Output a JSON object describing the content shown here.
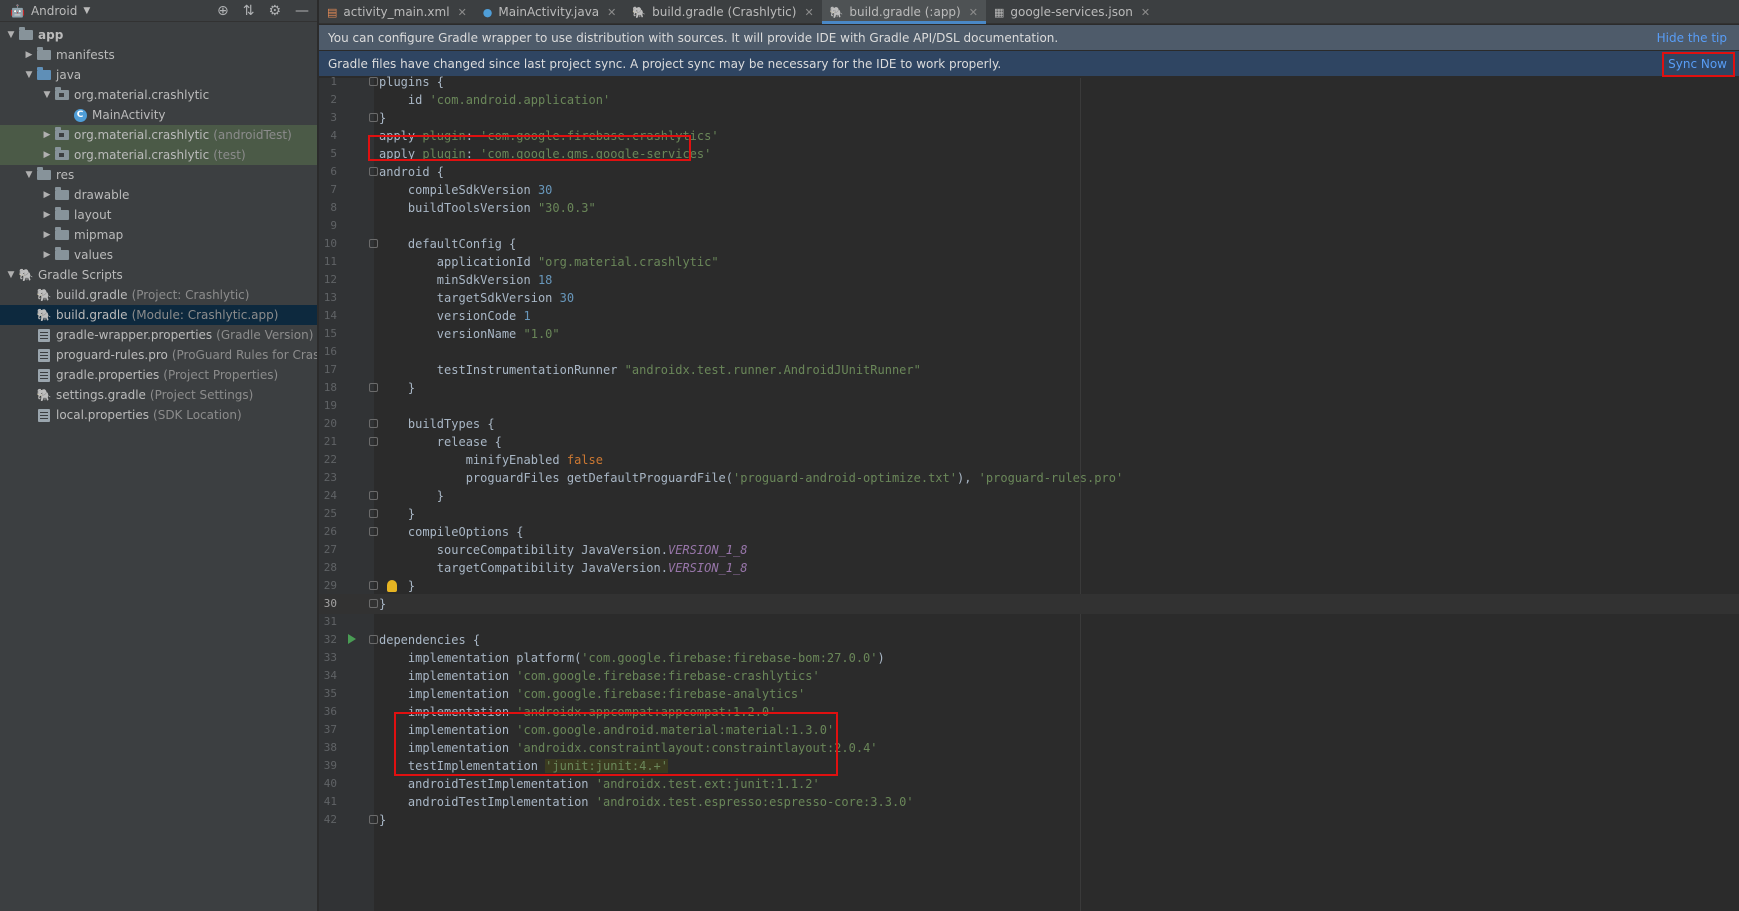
{
  "project_panel": {
    "title": "Android",
    "tree": [
      {
        "label": "app",
        "hint": "",
        "depth": 0,
        "expanded": true,
        "icon": "module-folder-icon",
        "bold": true,
        "hl": ""
      },
      {
        "label": "manifests",
        "hint": "",
        "depth": 1,
        "expanded": false,
        "icon": "folder-icon",
        "hl": ""
      },
      {
        "label": "java",
        "hint": "",
        "depth": 1,
        "expanded": true,
        "icon": "source-folder-icon",
        "hl": ""
      },
      {
        "label": "org.material.crashlytic",
        "hint": "",
        "depth": 2,
        "expanded": true,
        "icon": "package-icon",
        "hl": ""
      },
      {
        "label": "MainActivity",
        "hint": "",
        "depth": 3,
        "expanded": null,
        "icon": "class-icon",
        "hl": ""
      },
      {
        "label": "org.material.crashlytic",
        "hint": "(androidTest)",
        "depth": 2,
        "expanded": false,
        "icon": "package-icon",
        "hl": "green"
      },
      {
        "label": "org.material.crashlytic",
        "hint": "(test)",
        "depth": 2,
        "expanded": false,
        "icon": "package-icon",
        "hl": "green"
      },
      {
        "label": "res",
        "hint": "",
        "depth": 1,
        "expanded": true,
        "icon": "resource-folder-icon",
        "hl": ""
      },
      {
        "label": "drawable",
        "hint": "",
        "depth": 2,
        "expanded": false,
        "icon": "folder-icon",
        "hl": ""
      },
      {
        "label": "layout",
        "hint": "",
        "depth": 2,
        "expanded": false,
        "icon": "folder-icon",
        "hl": ""
      },
      {
        "label": "mipmap",
        "hint": "",
        "depth": 2,
        "expanded": false,
        "icon": "folder-icon",
        "hl": ""
      },
      {
        "label": "values",
        "hint": "",
        "depth": 2,
        "expanded": false,
        "icon": "folder-icon",
        "hl": ""
      },
      {
        "label": "Gradle Scripts",
        "hint": "",
        "depth": 0,
        "expanded": true,
        "icon": "gradle-icon",
        "hl": ""
      },
      {
        "label": "build.gradle",
        "hint": "(Project: Crashlytic)",
        "depth": 1,
        "expanded": null,
        "icon": "gradle-icon",
        "hl": ""
      },
      {
        "label": "build.gradle",
        "hint": "(Module: Crashlytic.app)",
        "depth": 1,
        "expanded": null,
        "icon": "gradle-icon",
        "hl": "selected"
      },
      {
        "label": "gradle-wrapper.properties",
        "hint": "(Gradle Version)",
        "depth": 1,
        "expanded": null,
        "icon": "properties-icon",
        "hl": ""
      },
      {
        "label": "proguard-rules.pro",
        "hint": "(ProGuard Rules for Crashlyti",
        "depth": 1,
        "expanded": null,
        "icon": "properties-icon",
        "hl": ""
      },
      {
        "label": "gradle.properties",
        "hint": "(Project Properties)",
        "depth": 1,
        "expanded": null,
        "icon": "properties-icon",
        "hl": ""
      },
      {
        "label": "settings.gradle",
        "hint": "(Project Settings)",
        "depth": 1,
        "expanded": null,
        "icon": "gradle-icon",
        "hl": ""
      },
      {
        "label": "local.properties",
        "hint": "(SDK Location)",
        "depth": 1,
        "expanded": null,
        "icon": "properties-icon",
        "hl": ""
      }
    ]
  },
  "tabs": [
    {
      "label": "activity_main.xml",
      "icon": "xml-file-icon",
      "active": false
    },
    {
      "label": "MainActivity.java",
      "icon": "java-class-icon",
      "active": false
    },
    {
      "label": "build.gradle (Crashlytic)",
      "icon": "gradle-icon",
      "active": false
    },
    {
      "label": "build.gradle (:app)",
      "icon": "gradle-icon",
      "active": true
    },
    {
      "label": "google-services.json",
      "icon": "json-file-icon",
      "active": false
    }
  ],
  "tip_banner": {
    "text": "You can configure Gradle wrapper to use distribution with sources. It will provide IDE with Gradle API/DSL documentation.",
    "action": "Hide the tip"
  },
  "sync_banner": {
    "text": "Gradle files have changed since last project sync. A project sync may be necessary for the IDE to work properly.",
    "action": "Sync Now"
  },
  "editor": {
    "current_line": 30,
    "lines": [
      {
        "n": 1,
        "tokens": [
          {
            "t": "plugins {"
          }
        ]
      },
      {
        "n": 2,
        "tokens": [
          {
            "t": "    id "
          },
          {
            "t": "'com.android.application'",
            "c": "s"
          }
        ]
      },
      {
        "n": 3,
        "tokens": [
          {
            "t": "}"
          }
        ]
      },
      {
        "n": 4,
        "tokens": [
          {
            "t": "apply "
          },
          {
            "t": "plugin",
            "c": "s"
          },
          {
            "t": ": "
          },
          {
            "t": "'com.google.firebase.crashlytics'",
            "c": "s"
          }
        ]
      },
      {
        "n": 5,
        "tokens": [
          {
            "t": "apply "
          },
          {
            "t": "plugin",
            "c": "s"
          },
          {
            "t": ": "
          },
          {
            "t": "'com.google.gms.google-services'",
            "c": "s"
          }
        ]
      },
      {
        "n": 6,
        "tokens": [
          {
            "t": "android {"
          }
        ]
      },
      {
        "n": 7,
        "tokens": [
          {
            "t": "    compileSdkVersion "
          },
          {
            "t": "30",
            "c": "n"
          }
        ]
      },
      {
        "n": 8,
        "tokens": [
          {
            "t": "    buildToolsVersion "
          },
          {
            "t": "\"30.0.3\"",
            "c": "s"
          }
        ]
      },
      {
        "n": 9,
        "tokens": []
      },
      {
        "n": 10,
        "tokens": [
          {
            "t": "    defaultConfig {"
          }
        ]
      },
      {
        "n": 11,
        "tokens": [
          {
            "t": "        applicationId "
          },
          {
            "t": "\"org.material.crashlytic\"",
            "c": "s"
          }
        ]
      },
      {
        "n": 12,
        "tokens": [
          {
            "t": "        minSdkVersion "
          },
          {
            "t": "18",
            "c": "n"
          }
        ]
      },
      {
        "n": 13,
        "tokens": [
          {
            "t": "        targetSdkVersion "
          },
          {
            "t": "30",
            "c": "n"
          }
        ]
      },
      {
        "n": 14,
        "tokens": [
          {
            "t": "        versionCode "
          },
          {
            "t": "1",
            "c": "n"
          }
        ]
      },
      {
        "n": 15,
        "tokens": [
          {
            "t": "        versionName "
          },
          {
            "t": "\"1.0\"",
            "c": "s"
          }
        ]
      },
      {
        "n": 16,
        "tokens": []
      },
      {
        "n": 17,
        "tokens": [
          {
            "t": "        testInstrumentationRunner "
          },
          {
            "t": "\"androidx.test.runner.AndroidJUnitRunner\"",
            "c": "s"
          }
        ]
      },
      {
        "n": 18,
        "tokens": [
          {
            "t": "    }"
          }
        ]
      },
      {
        "n": 19,
        "tokens": []
      },
      {
        "n": 20,
        "tokens": [
          {
            "t": "    buildTypes {"
          }
        ]
      },
      {
        "n": 21,
        "tokens": [
          {
            "t": "        release {"
          }
        ]
      },
      {
        "n": 22,
        "tokens": [
          {
            "t": "            minifyEnabled "
          },
          {
            "t": "false",
            "c": "k"
          }
        ]
      },
      {
        "n": 23,
        "tokens": [
          {
            "t": "            proguardFiles getDefaultProguardFile("
          },
          {
            "t": "'proguard-android-optimize.txt'",
            "c": "s"
          },
          {
            "t": "), "
          },
          {
            "t": "'proguard-rules.pro'",
            "c": "s"
          }
        ]
      },
      {
        "n": 24,
        "tokens": [
          {
            "t": "        }"
          }
        ]
      },
      {
        "n": 25,
        "tokens": [
          {
            "t": "    }"
          }
        ]
      },
      {
        "n": 26,
        "tokens": [
          {
            "t": "    compileOptions {"
          }
        ]
      },
      {
        "n": 27,
        "tokens": [
          {
            "t": "        sourceCompatibility JavaVersion."
          },
          {
            "t": "VERSION_1_8",
            "c": "f"
          }
        ]
      },
      {
        "n": 28,
        "tokens": [
          {
            "t": "        targetCompatibility JavaVersion."
          },
          {
            "t": "VERSION_1_8",
            "c": "f"
          }
        ]
      },
      {
        "n": 29,
        "tokens": [
          {
            "t": "    }"
          }
        ]
      },
      {
        "n": 30,
        "tokens": [
          {
            "t": "}"
          }
        ]
      },
      {
        "n": 31,
        "tokens": []
      },
      {
        "n": 32,
        "tokens": [
          {
            "t": "dependencies {"
          }
        ]
      },
      {
        "n": 33,
        "tokens": [
          {
            "t": "    implementation platform("
          },
          {
            "t": "'com.google.firebase:firebase-bom:27.0.0'",
            "c": "s"
          },
          {
            "t": ")"
          }
        ]
      },
      {
        "n": 34,
        "tokens": [
          {
            "t": "    implementation "
          },
          {
            "t": "'com.google.firebase:firebase-crashlytics'",
            "c": "s"
          }
        ]
      },
      {
        "n": 35,
        "tokens": [
          {
            "t": "    implementation "
          },
          {
            "t": "'com.google.firebase:firebase-analytics'",
            "c": "s"
          }
        ]
      },
      {
        "n": 36,
        "tokens": [
          {
            "t": "    implementation "
          },
          {
            "t": "'androidx.appcompat:appcompat:1.2.0'",
            "c": "s"
          }
        ]
      },
      {
        "n": 37,
        "tokens": [
          {
            "t": "    implementation "
          },
          {
            "t": "'com.google.android.material:material:1.3.0'",
            "c": "s"
          }
        ]
      },
      {
        "n": 38,
        "tokens": [
          {
            "t": "    implementation "
          },
          {
            "t": "'androidx.constraintlayout:constraintlayout:2.0.4'",
            "c": "s"
          }
        ]
      },
      {
        "n": 39,
        "tokens": [
          {
            "t": "    testImplementation "
          },
          {
            "t": "'junit:junit:4.+'",
            "c": "s",
            "hl": true
          }
        ]
      },
      {
        "n": 40,
        "tokens": [
          {
            "t": "    androidTestImplementation "
          },
          {
            "t": "'androidx.test.ext:junit:1.1.2'",
            "c": "s"
          }
        ]
      },
      {
        "n": 41,
        "tokens": [
          {
            "t": "    androidTestImplementation "
          },
          {
            "t": "'androidx.test.espresso:espresso-core:3.3.0'",
            "c": "s"
          }
        ]
      },
      {
        "n": 42,
        "tokens": [
          {
            "t": "}"
          }
        ]
      }
    ],
    "fold_lines": [
      1,
      3,
      6,
      10,
      18,
      20,
      21,
      24,
      25,
      26,
      29,
      30,
      32,
      42
    ],
    "run_line": 32,
    "bulb_line": 29
  }
}
